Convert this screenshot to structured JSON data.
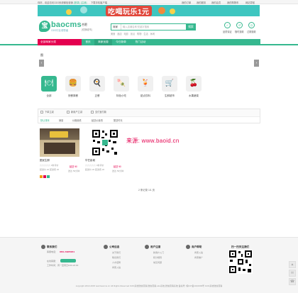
{
  "topbar": {
    "welcome": "你好，欢迎访问O2O系统微信营销",
    "login": "[登录]",
    "register": "[注册]",
    "app": "下载手机客户端",
    "links": [
      "我的订单",
      "我的服务",
      "我的会员",
      "我的购物车",
      "网站导航"
    ]
  },
  "banner": {
    "text": "吃喝玩乐1元"
  },
  "header": {
    "logo_glyph": "宝",
    "brand": "baocms",
    "slogan": "O2O行业领导者",
    "city": "合肥",
    "city_switch": "[切换城市]",
    "search_scope": "商家",
    "search_placeholder": "输入店铺名称/关键字搜索",
    "search_button": "搜索",
    "hot_words": [
      "美食",
      "酒店",
      "电影",
      "景点",
      "购物",
      "生活",
      "休闲"
    ],
    "icons": [
      {
        "name": "quality-icon",
        "label": "品质保证"
      },
      {
        "name": "refund-icon",
        "label": "随时退款"
      },
      {
        "name": "expire-icon",
        "label": "过期退款"
      }
    ]
  },
  "nav": {
    "category_all": "全部商家分类",
    "items": [
      "首页",
      "商家优惠",
      "今日新单",
      "热门活动"
    ]
  },
  "slider": {
    "title": "图",
    "prev": "‹",
    "next": "›",
    "categories": [
      {
        "name": "all-icon",
        "glyph": "🍽",
        "label": "全部"
      },
      {
        "name": "fastfood-icon",
        "glyph": "🍔",
        "label": "快餐简餐"
      },
      {
        "name": "breakfast-icon",
        "glyph": "🍳",
        "label": "正餐"
      },
      {
        "name": "snack-icon",
        "glyph": "🍡",
        "label": "特色小吃"
      },
      {
        "name": "drink-icon",
        "glyph": "🍹",
        "label": "甜点饮料"
      },
      {
        "name": "market-icon",
        "glyph": "🛒",
        "label": "生鲜超市"
      },
      {
        "name": "fruit-icon",
        "glyph": "🍒",
        "label": "水果蔬菜"
      }
    ]
  },
  "filter": {
    "checks": [
      "下单立减",
      "新用户立减",
      "支付宝付款"
    ],
    "sorts": [
      "默认排序",
      "销量",
      "价格最低",
      "起送价最低",
      "配送时长"
    ]
  },
  "products": [
    {
      "name": "图优生鲜",
      "meta1": "☆☆☆☆☆ 0条评价",
      "price": "起送 ¥0",
      "meta2": "起送价 ¥0  配送费 ¥0",
      "tag": "送达 59分钟"
    },
    {
      "name": "华艺影城",
      "meta1": "☆☆☆☆☆ 0条评价",
      "price": "起送 ¥0",
      "meta2": "起送价 ¥0  配送费 ¥0",
      "tag": "送达 59分钟"
    }
  ],
  "watermark": "来源: www.baoid.cn",
  "pager": "2 条记录 1/1 页",
  "footer": {
    "contact": {
      "title": "联系我们",
      "phone_label": "客服电话：",
      "phone": "0551-79875874",
      "online_label": "在线客服：",
      "time": "工作时间：周一至周日9:00-22:00"
    },
    "cols": [
      {
        "title": "公司信息",
        "items": [
          "关于我们",
          "联系我们",
          "人才招聘",
          "商家入驻"
        ]
      },
      {
        "title": "用户注意",
        "items": [
          "新用户入门",
          "积分规则",
          "常见问题"
        ]
      },
      {
        "title": "商户帮助",
        "items": [
          "商家入驻",
          "商家推广"
        ]
      }
    ],
    "qr_title": "扫一扫关注我们",
    "copyright": "copyright 2013-2015 test.baocms.cn All Rights Reserved O2O系统微信营销,微信营销,o2o系统,微信营销系统 备案号: 皖ICP备1010009号 O2O系统微信营销"
  },
  "colors": {
    "accent": "#36b88f",
    "brand_red": "#e4004f"
  }
}
